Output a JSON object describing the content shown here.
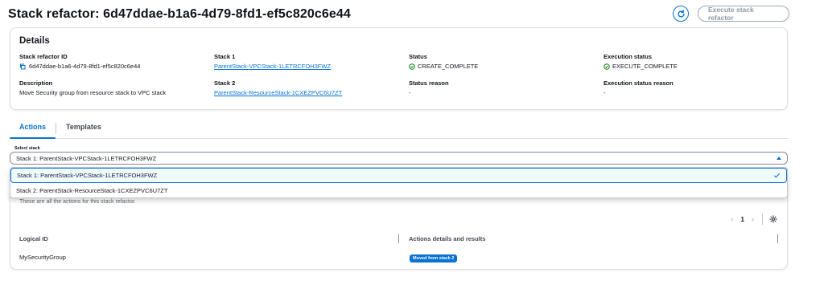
{
  "header": {
    "title": "Stack refactor: 6d47ddae-b1a6-4d79-8fd1-ef5c820c6e44",
    "execute_label": "Execute stack refactor",
    "refresh_icon": "refresh-icon"
  },
  "details": {
    "heading": "Details",
    "stack_refactor_id_label": "Stack refactor ID",
    "stack_refactor_id": "6d47ddae-b1a6-4d79-8fd1-ef5c820c6e44",
    "stack1_label": "Stack 1",
    "stack1_value": "ParentStack-VPCStack-1LETRCFOH3FWZ",
    "status_label": "Status",
    "status_value": "CREATE_COMPLETE",
    "exec_status_label": "Execution status",
    "exec_status_value": "EXECUTE_COMPLETE",
    "description_label": "Description",
    "description_value": "Move Security group from resource stack to VPC stack",
    "stack2_label": "Stack 2",
    "stack2_value": "ParentStack-ResourceStack-1CXEZPVC6U7ZT",
    "status_reason_label": "Status reason",
    "status_reason_value": "-",
    "exec_status_reason_label": "Execution status reason",
    "exec_status_reason_value": "-",
    "success_color": "#037f0c",
    "link_color": "#0972d3"
  },
  "tabs": [
    {
      "label": "Actions",
      "active": true
    },
    {
      "label": "Templates",
      "active": false
    }
  ],
  "select": {
    "label": "Select stack",
    "value": "Stack 1: ParentStack-VPCStack-1LETRCFOH3FWZ",
    "options": [
      {
        "label": "Stack 1: ParentStack-VPCStack-1LETRCFOH3FWZ",
        "selected": true
      },
      {
        "label": "Stack 2: ParentStack-ResourceStack-1CXEZPVC6U7ZT",
        "selected": false
      }
    ]
  },
  "actions": {
    "description": "These are all the actions for this stack refactor.",
    "page": "1",
    "columns": [
      "Logical ID",
      "Actions details and results"
    ],
    "rows": [
      {
        "logical_id": "MySecurityGroup",
        "badge": "Moved from stack 2"
      }
    ]
  }
}
